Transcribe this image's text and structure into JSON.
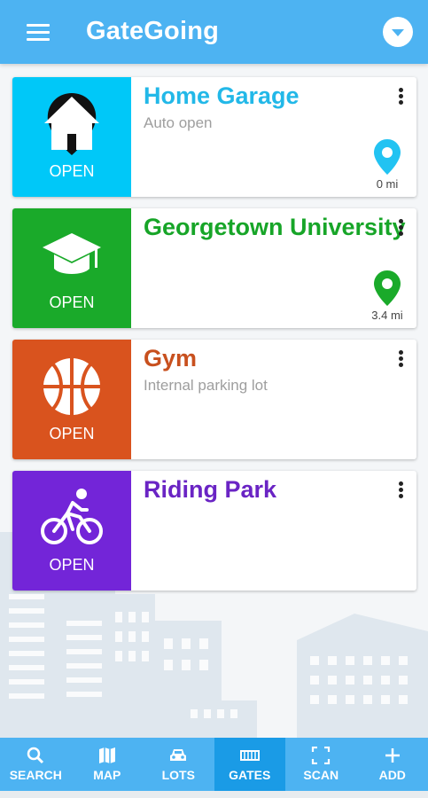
{
  "app": {
    "title": "GateGoing"
  },
  "colors": {
    "appbar": "#4db3f2",
    "nav_active": "#1a9be6"
  },
  "gates": [
    {
      "name": "Home Garage",
      "subtitle": "Auto open",
      "action": "OPEN",
      "icon": "house-icon",
      "color": "#00c8f8",
      "name_color": "#22b8e8",
      "distance": "0 mi",
      "pin_color": "#22c3f2",
      "geofence": true
    },
    {
      "name": "Georgetown University",
      "subtitle": "",
      "action": "OPEN",
      "icon": "graduation-cap-icon",
      "color": "#1aaa2a",
      "name_color": "#17a528",
      "distance": "3.4 mi",
      "pin_color": "#1aaa2a",
      "geofence": false
    },
    {
      "name": "Gym",
      "subtitle": "Internal parking lot",
      "action": "OPEN",
      "icon": "basketball-icon",
      "color": "#d9531e",
      "name_color": "#c8501e",
      "distance": "",
      "geofence": false
    },
    {
      "name": "Riding Park",
      "subtitle": "",
      "action": "OPEN",
      "icon": "bicycle-icon",
      "color": "#7325d8",
      "name_color": "#6a24c4",
      "distance": "",
      "geofence": false
    }
  ],
  "nav": [
    {
      "label": "SEARCH",
      "icon": "search-icon",
      "active": false
    },
    {
      "label": "MAP",
      "icon": "map-icon",
      "active": false
    },
    {
      "label": "LOTS",
      "icon": "car-icon",
      "active": false
    },
    {
      "label": "GATES",
      "icon": "gate-icon",
      "active": true
    },
    {
      "label": "SCAN",
      "icon": "scan-icon",
      "active": false
    },
    {
      "label": "ADD",
      "icon": "plus-icon",
      "active": false
    }
  ]
}
